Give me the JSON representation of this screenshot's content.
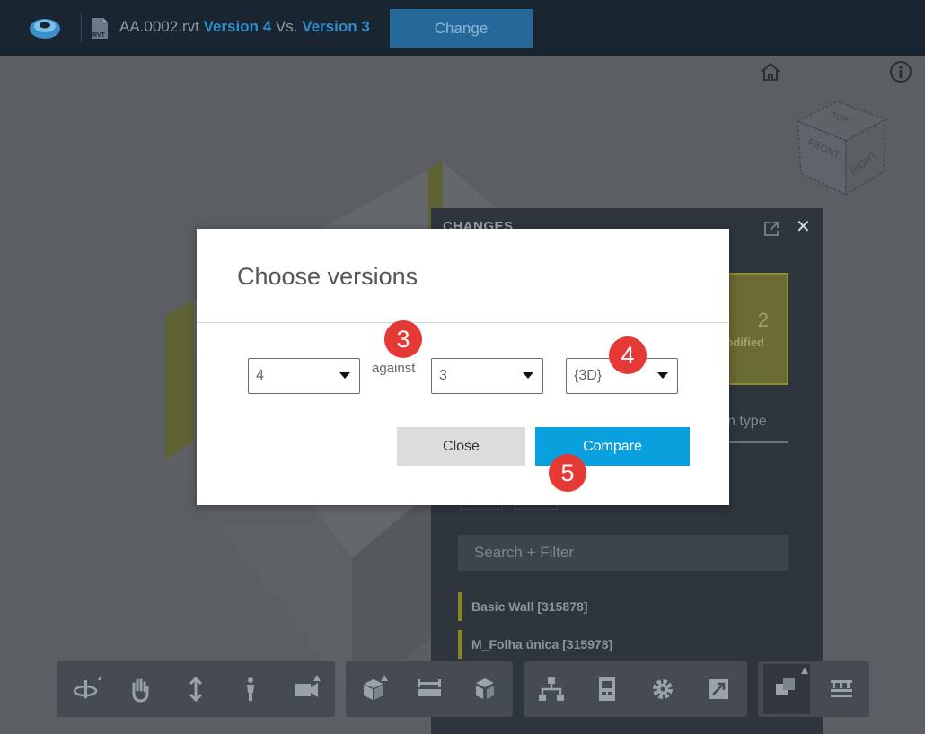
{
  "header": {
    "file_name": "AA.0002.rvt",
    "version_a": "Version 4",
    "vs_text": " Vs. ",
    "version_b": "Version 3",
    "change_label": "Change",
    "file_type_icon": "RVT"
  },
  "changes_panel": {
    "title": "CHANGES",
    "modified_count": "2",
    "modified_label": "odified",
    "group_tab": "n type",
    "search_placeholder": "Search + Filter",
    "items": [
      {
        "label": "Basic Wall [315878]"
      },
      {
        "label": "M_Folha única [315978]"
      }
    ]
  },
  "dialog": {
    "title": "Choose versions",
    "from_version": "4",
    "against_label": "against",
    "to_version": "3",
    "view": "{3D}",
    "close_label": "Close",
    "compare_label": "Compare"
  },
  "badges": [
    "3",
    "4",
    "5"
  ],
  "viewcube": {
    "top": "TOP",
    "front": "FRONT",
    "right": "RIGHT"
  },
  "toolbar": {
    "nav_tools": [
      "orbit-icon",
      "pan-icon",
      "zoom-icon",
      "first-person-icon",
      "camera-icon"
    ],
    "model_tools": [
      "section-box-icon",
      "measure-icon",
      "explode-icon"
    ],
    "panel_tools": [
      "model-browser-icon",
      "properties-icon",
      "settings-icon",
      "fullscreen-icon"
    ],
    "extra_tools": [
      "compare-icon",
      "list-icon"
    ]
  },
  "colors": {
    "accent": "#0a9fdd",
    "topbar": "#1a2532",
    "modified": "#86862d",
    "badge": "#e53935"
  }
}
